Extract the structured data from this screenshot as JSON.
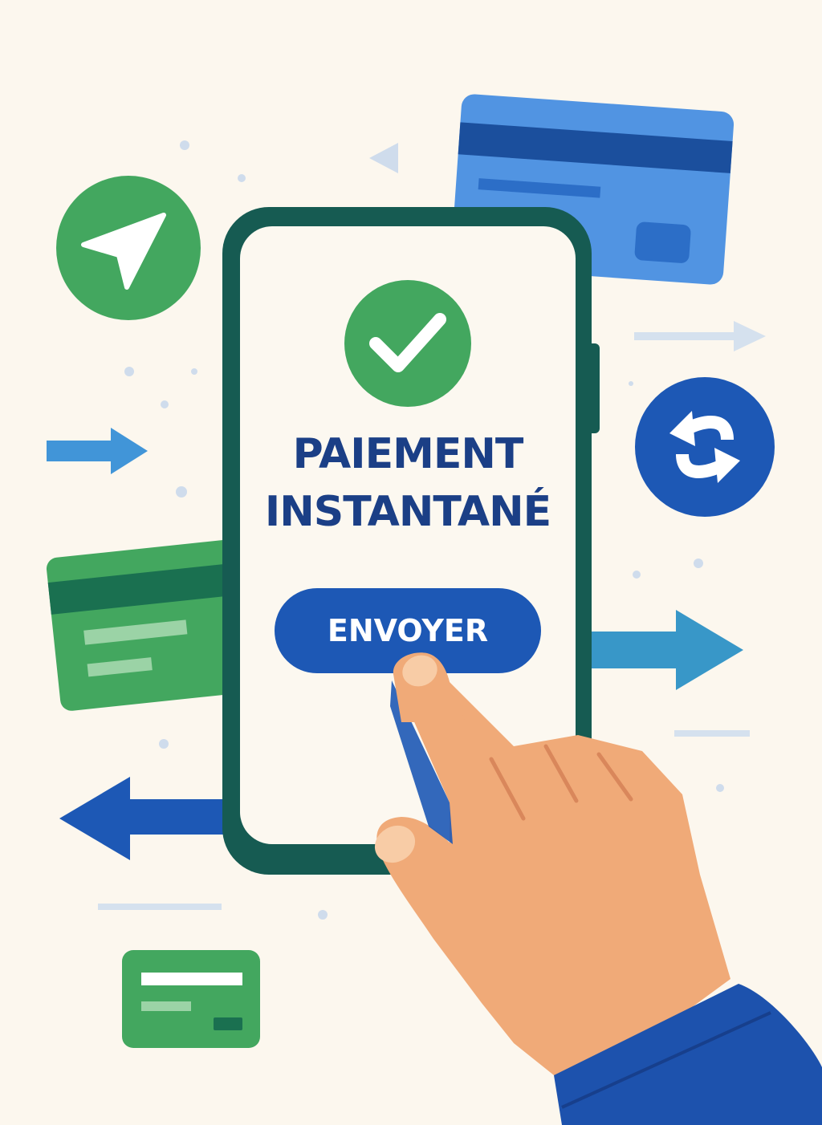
{
  "phone": {
    "title_line1": "PAIEMENT",
    "title_line2": "INSTANTANÉ",
    "send_label": "ENVOYER"
  },
  "icons": {
    "success": "checkmark-icon",
    "send": "send-arrow-icon",
    "exchange": "exchange-arrows-icon"
  },
  "colors": {
    "background": "#fcf7ee",
    "primary_blue": "#1d58b5",
    "green": "#43a75f",
    "phone_frame": "#165b52",
    "skin": "#f0aa78",
    "title_text": "#1b3f86"
  }
}
